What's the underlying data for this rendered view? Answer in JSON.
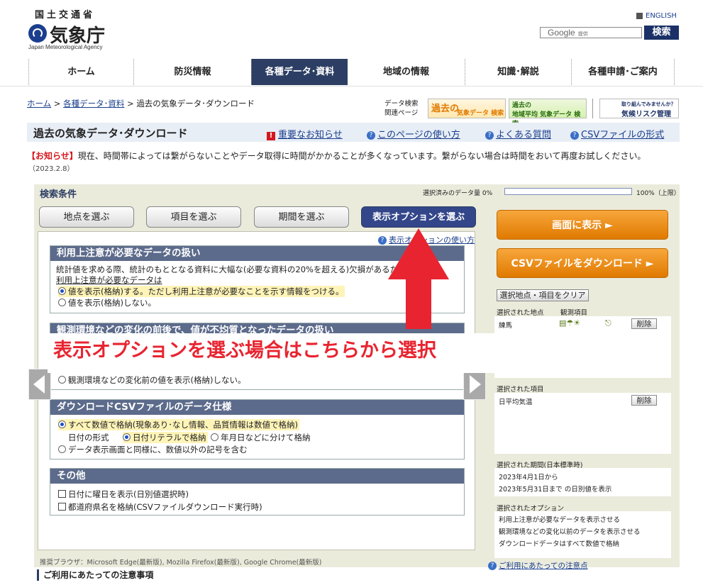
{
  "header": {
    "logo_ministry": "国土交通省",
    "logo_name": "気象庁",
    "logo_english": "Japan Meteorological Agency",
    "english_link": "ENGLISH",
    "search_placeholder": "Google",
    "search_placeholder_small": "提供",
    "search_button": "検索"
  },
  "nav": [
    {
      "label": "ホーム",
      "active": false
    },
    {
      "label": "防災情報",
      "active": false
    },
    {
      "label": "各種データ･資料",
      "active": true
    },
    {
      "label": "地域の情報",
      "active": false
    },
    {
      "label": "知識･解説",
      "active": false
    },
    {
      "label": "各種申請･ご案内",
      "active": false
    }
  ],
  "breadcrumb": {
    "home": "ホーム",
    "sep": " > ",
    "data": "各種データ･資料",
    "current": "過去の気象データ･ダウンロード"
  },
  "related": {
    "label_line1": "データ検索",
    "label_line2": "関連ページ",
    "banner1_main": "過去の",
    "banner1_sub": "気象データ 検索",
    "banner2_main": "過去の",
    "banner2_sub": "地域平均 気象データ 検索",
    "banner3_main": "取り組んでみませんか？",
    "banner3_sub": "気候リスク管理"
  },
  "title_bar": {
    "title": "過去の気象データ･ダウンロード",
    "link_notice": "重要なお知らせ",
    "link_usage": "このページの使い方",
    "link_faq": "よくある質問",
    "link_csv": "CSVファイルの形式"
  },
  "notice": {
    "label": "【お知らせ】",
    "text": "現在、時間帯によっては繋がらないことやデータ取得に時間がかかることが多くなっています。繋がらない場合は時間をおいて再度お試しください。",
    "date": "（2023.2.8）"
  },
  "search": {
    "label": "検索条件",
    "meter_label": "選択済みのデータ量 0%",
    "meter_max": "100%（上限）",
    "meter_fill": 0,
    "tabs": [
      {
        "label": "地点を選ぶ",
        "active": false
      },
      {
        "label": "項目を選ぶ",
        "active": false
      },
      {
        "label": "期間を選ぶ",
        "active": false
      },
      {
        "label": "表示オプションを選ぶ",
        "active": true
      }
    ],
    "help_link": "表示オプションの使い方"
  },
  "sections": {
    "caution": {
      "title": "利用上注意が必要なデータの扱い",
      "desc": "統計値を求める際、統計のもととなる資料に大幅な(必要な資料の20%を超える)欠損があるため",
      "desc_link": "利用上注意が必要なデータは",
      "opt1": "値を表示(格納)する。ただし利用上注意が必要なことを示す情報をつける。",
      "opt2": "値を表示(格納)しない。"
    },
    "env": {
      "title": "観測環境などの変化の前後で、値が不均質となったデータの扱い",
      "opt2": "観測環境などの変化前の値を表示(格納)しない。"
    },
    "csv": {
      "title": "ダウンロードCSVファイルのデータ仕様",
      "opt1": "すべて数値で格納(現象あり･なし情報、品質情報は数値で格納)",
      "date_label": "日付の形式",
      "date_opt1": "日付リテラルで格納",
      "date_opt2": "年月日などに分けて格納",
      "opt2": "データ表示画面と同様に、数値以外の記号を含む"
    },
    "other": {
      "title": "その他",
      "chk1": "日付に曜日を表示(日別値選択時)",
      "chk2": "都道府県名を格納(CSVファイルダウンロード実行時)"
    }
  },
  "overlay_text": "表示オプションを選ぶ場合はこちらから選択",
  "footer": {
    "browsers": "推奨ブラウザ：Microsoft Edge(最新版), Mozilla Firefox(最新版), Google Chrome(最新版)",
    "notes_title": "ご利用にあたっての注意事項",
    "notes_link": "ご利用にあたっての注意点"
  },
  "right": {
    "show_button": "画面に表示",
    "csv_button": "CSVファイルをダウンロード",
    "clear_button": "選択地点・項目をクリア",
    "stations_label": "選択された地点",
    "items_label": "観測項目",
    "station_name": "練馬",
    "delete": "削除",
    "selected_items_label": "選択された項目",
    "item_name": "日平均気温",
    "period_label": "選択された期間(日本標準時)",
    "period_from": "2023年4月1日から",
    "period_to": "2023年5月31日まで の日別値を表示",
    "options_label": "選択されたオプション",
    "option1": "利用上注意が必要なデータを表示させる",
    "option2": "観測環境などの変化以前のデータを表示させる",
    "option3": "ダウンロードデータはすべて数値で格納"
  },
  "colors": {
    "nav_active": "#2c3e63",
    "accent_orange": "#f39a2c",
    "annotation_red": "#e82430"
  }
}
